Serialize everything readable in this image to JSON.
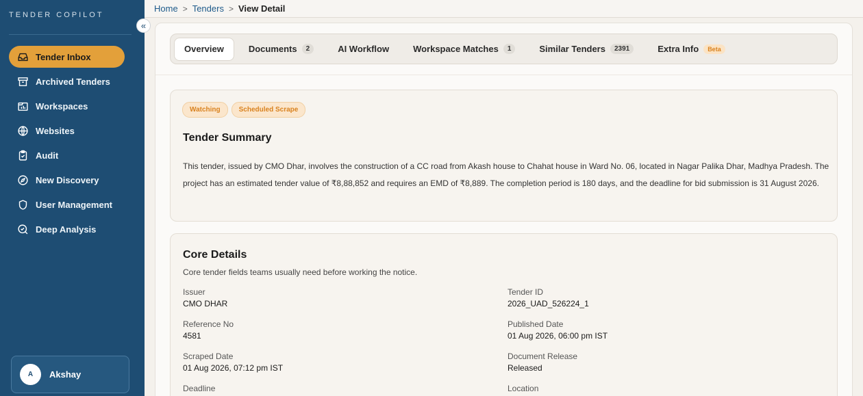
{
  "sidebar": {
    "brand": "TENDER COPILOT",
    "items": [
      {
        "label": "Tender Inbox",
        "icon": "inbox-icon",
        "active": true
      },
      {
        "label": "Archived Tenders",
        "icon": "archive-icon"
      },
      {
        "label": "Workspaces",
        "icon": "workspace-icon"
      },
      {
        "label": "Websites",
        "icon": "globe-icon"
      },
      {
        "label": "Audit",
        "icon": "clipboard-icon"
      },
      {
        "label": "New Discovery",
        "icon": "compass-icon"
      },
      {
        "label": "User Management",
        "icon": "shield-icon"
      },
      {
        "label": "Deep Analysis",
        "icon": "search-analysis-icon"
      }
    ],
    "collapse_glyph": "«",
    "user": {
      "initial": "A",
      "name": "Akshay"
    }
  },
  "breadcrumb": {
    "home": "Home",
    "tenders": "Tenders",
    "current": "View Detail",
    "sep": ">"
  },
  "tabs": [
    {
      "label": "Overview",
      "active": true
    },
    {
      "label": "Documents",
      "count": "2"
    },
    {
      "label": "AI Workflow"
    },
    {
      "label": "Workspace Matches",
      "count": "1"
    },
    {
      "label": "Similar Tenders",
      "count": "2391"
    },
    {
      "label": "Extra Info",
      "tag": "Beta"
    }
  ],
  "summary": {
    "badges": [
      "Watching",
      "Scheduled Scrape"
    ],
    "title": "Tender Summary",
    "text": "This tender, issued by CMO Dhar, involves the construction of a CC road from Akash house to Chahat house in Ward No. 06, located in Nagar Palika Dhar, Madhya Pradesh. The project has an estimated tender value of ₹8,88,852 and requires an EMD of ₹8,889. The completion period is 180 days, and the deadline for bid submission is 31 August 2026."
  },
  "core": {
    "title": "Core Details",
    "subtitle": "Core tender fields teams usually need before working the notice.",
    "fields": [
      {
        "label": "Issuer",
        "value": "CMO DHAR"
      },
      {
        "label": "Tender ID",
        "value": "2026_UAD_526224_1"
      },
      {
        "label": "Reference No",
        "value": "4581"
      },
      {
        "label": "Published Date",
        "value": "01 Aug 2026, 06:00 pm IST"
      },
      {
        "label": "Scraped Date",
        "value": "01 Aug 2026, 07:12 pm IST"
      },
      {
        "label": "Document Release",
        "value": "Released"
      },
      {
        "label": "Deadline",
        "value": ""
      },
      {
        "label": "Location",
        "value": ""
      }
    ]
  },
  "colors": {
    "sidebar": "#1e4d73",
    "accent": "#e3a03a",
    "badge": "#d9821f"
  }
}
